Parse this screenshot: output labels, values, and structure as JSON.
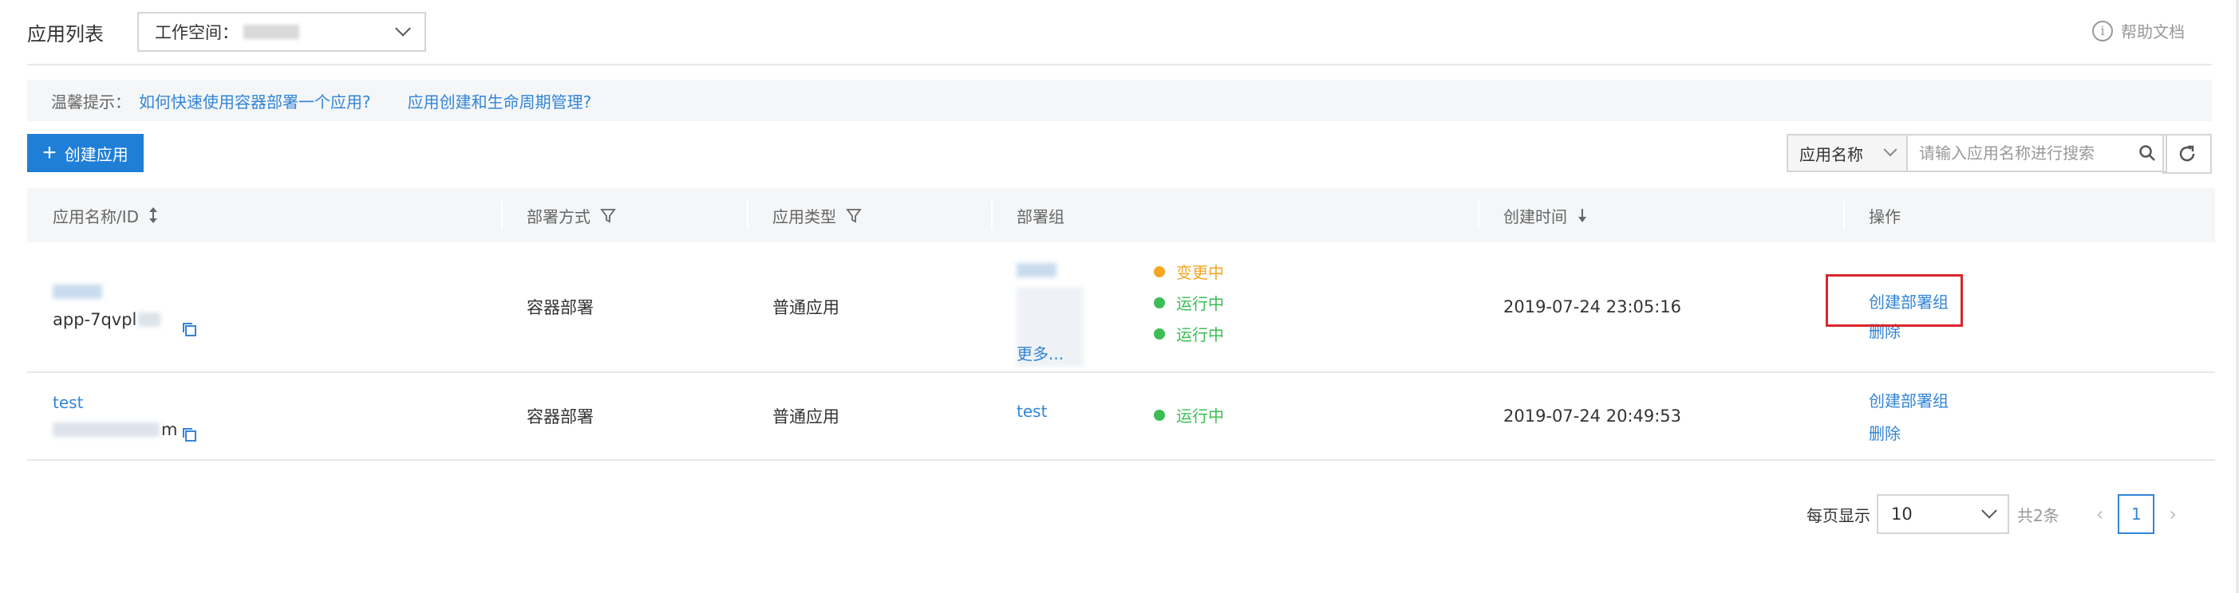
{
  "header": {
    "title": "应用列表",
    "workspace_label": "工作空间：",
    "help_text": "帮助文档"
  },
  "tip": {
    "label": "温馨提示：",
    "links": [
      "如何快速使用容器部署一个应用?",
      "应用创建和生命周期管理?"
    ]
  },
  "toolbar": {
    "create_label": "创建应用",
    "search_field": "应用名称",
    "search_placeholder": "请输入应用名称进行搜索"
  },
  "table": {
    "columns": [
      "应用名称/ID",
      "部署方式",
      "应用类型",
      "部署组",
      "创建时间",
      "操作"
    ],
    "rows": [
      {
        "name": "",
        "id": "app-7qvpl",
        "deploy": "容器部署",
        "type": "普通应用",
        "group_more": "更多...",
        "statuses": [
          {
            "text": "变更中",
            "color": "#f5a623"
          },
          {
            "text": "运行中",
            "color": "#3dbd55"
          },
          {
            "text": "运行中",
            "color": "#3dbd55"
          }
        ],
        "created": "2019-07-24 23:05:16",
        "ops": [
          "创建部署组",
          "删除"
        ]
      },
      {
        "name": "test",
        "id": "m",
        "deploy": "容器部署",
        "type": "普通应用",
        "group": "test",
        "statuses": [
          {
            "text": "运行中",
            "color": "#3dbd55"
          }
        ],
        "created": "2019-07-24 20:49:53",
        "ops": [
          "创建部署组",
          "删除"
        ]
      }
    ]
  },
  "pagination": {
    "page_size_label": "每页显示",
    "page_size": "10",
    "total": "共2条",
    "current": "1"
  }
}
